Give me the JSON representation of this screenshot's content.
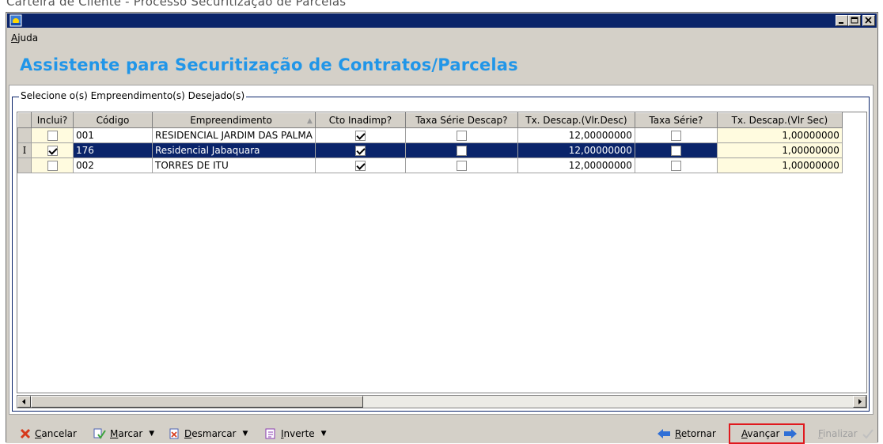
{
  "caption": "Carteira de Cliente - Processo Securitização de Parcelas",
  "menu": {
    "ajuda": "Ajuda"
  },
  "heading": "Assistente para Securitização de Contratos/Parcelas",
  "group_label": "Selecione o(s) Empreendimento(s) Desejado(s)",
  "columns": [
    "Inclui?",
    "Código",
    "Empreendimento",
    "Cto Inadimp?",
    "Taxa Série Descap?",
    "Tx. Descap.(Vlr.Desc)",
    "Taxa Série?",
    "Tx. Descap.(Vlr Sec)"
  ],
  "rows": [
    {
      "indicator": "",
      "inclui": false,
      "codigo": "001",
      "empreendimento": "RESIDENCIAL JARDIM DAS PALMA",
      "cto_inadimp": true,
      "taxa_serie_descap": false,
      "tx_descap_desc": "12,00000000",
      "taxa_serie": false,
      "tx_descap_sec": "1,00000000"
    },
    {
      "indicator": "I",
      "inclui": true,
      "codigo": "176",
      "empreendimento": "Residencial Jabaquara",
      "cto_inadimp": true,
      "taxa_serie_descap": false,
      "tx_descap_desc": "12,00000000",
      "taxa_serie": false,
      "tx_descap_sec": "1,00000000"
    },
    {
      "indicator": "",
      "inclui": false,
      "codigo": "002",
      "empreendimento": "TORRES DE ITU",
      "cto_inadimp": true,
      "taxa_serie_descap": false,
      "tx_descap_desc": "12,00000000",
      "taxa_serie": false,
      "tx_descap_sec": "1,00000000"
    }
  ],
  "selected_row": 1,
  "toolbar": {
    "cancelar": "Cancelar",
    "marcar": "Marcar",
    "desmarcar": "Desmarcar",
    "inverte": "Inverte",
    "retornar": "Retornar",
    "avancar": "Avançar",
    "finalizar": "Finalizar"
  },
  "icons": [
    "app-icon",
    "minimize-icon",
    "maximize-icon",
    "close-icon",
    "sort-arrow-icon",
    "cancel-x-icon",
    "mark-icon",
    "unmark-icon",
    "invert-icon",
    "back-arrow-icon",
    "forward-arrow-icon",
    "finish-check-icon",
    "scroll-left-icon",
    "scroll-right-icon"
  ],
  "colors": {
    "title_bar": "#0a246a",
    "heading": "#2196e8",
    "selection": "#0a246a",
    "cream_cell": "#fffbdf",
    "highlight_box": "#e0191e"
  }
}
